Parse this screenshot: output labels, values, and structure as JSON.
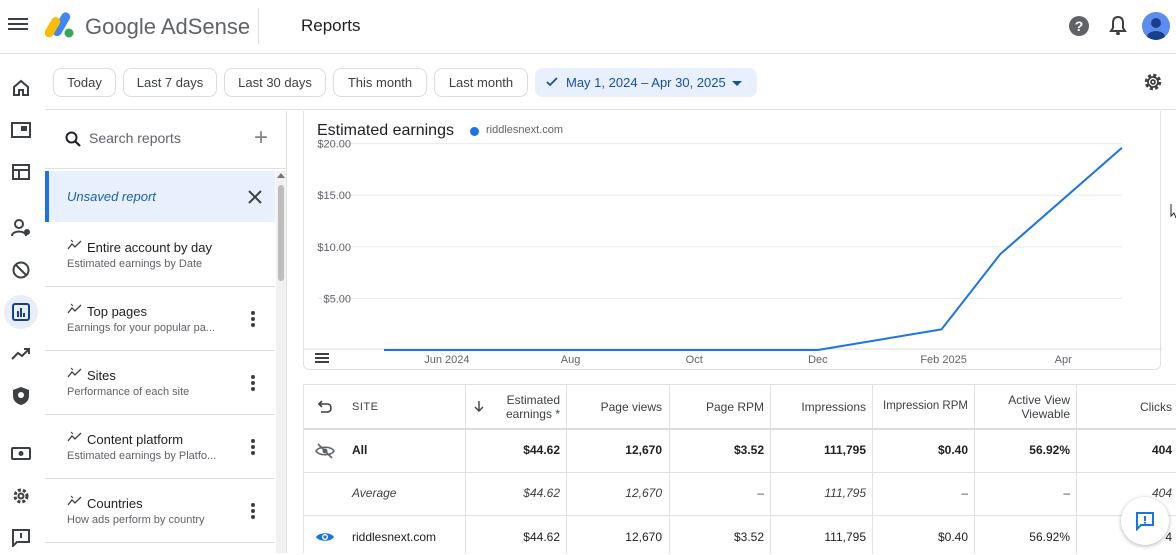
{
  "app": {
    "brand": "Google AdSense",
    "page_title": "Reports"
  },
  "topbar": {
    "help_glyph": "?"
  },
  "date_chips": [
    {
      "label": "Today",
      "active": false
    },
    {
      "label": "Last 7 days",
      "active": false
    },
    {
      "label": "Last 30 days",
      "active": false
    },
    {
      "label": "This month",
      "active": false
    },
    {
      "label": "Last month",
      "active": false
    },
    {
      "label": "May 1, 2024 – Apr 30, 2025",
      "active": true
    }
  ],
  "reports_panel": {
    "search_placeholder": "Search reports",
    "unsaved_label": "Unsaved report",
    "items": [
      {
        "title": "Entire account by day",
        "subtitle": "Estimated earnings by Date"
      },
      {
        "title": "Top pages",
        "subtitle": "Earnings for your popular pa..."
      },
      {
        "title": "Sites",
        "subtitle": "Performance of each site"
      },
      {
        "title": "Content platform",
        "subtitle": "Estimated earnings by Platfo..."
      },
      {
        "title": "Countries",
        "subtitle": "How ads perform by country"
      }
    ]
  },
  "chart": {
    "title": "Estimated earnings",
    "legend": "riddlesnext.com",
    "colors": {
      "series": "#1a73e8"
    }
  },
  "chart_data": {
    "type": "line",
    "title": "Estimated earnings",
    "y_ticks": [
      "$20.00",
      "$15.00",
      "$10.00",
      "$5.00"
    ],
    "x_ticks": [
      "Jun 2024",
      "Aug",
      "Oct",
      "Dec",
      "Feb 2025",
      "Apr"
    ],
    "ylim": [
      0,
      22
    ],
    "series": [
      {
        "name": "riddlesnext.com",
        "x": [
          "2024-05-01",
          "2024-12-01",
          "2025-01-31",
          "2025-03-01",
          "2025-04-30"
        ],
        "values": [
          0,
          0,
          2,
          9.3,
          19.6
        ]
      }
    ],
    "grid": true
  },
  "table": {
    "headers": [
      "SITE",
      "Estimated earnings *",
      "Page views",
      "Page RPM",
      "Impressions",
      "Impression RPM",
      "Active View Viewable",
      "Clicks"
    ],
    "header_earnings_line1": "Estimated",
    "header_earnings_line2": "earnings *",
    "header_active_line1": "Active View",
    "header_active_line2": "Viewable",
    "rows": [
      {
        "site": "All",
        "earnings": "$44.62",
        "page_views": "12,670",
        "page_rpm": "$3.52",
        "impressions": "111,795",
        "impression_rpm": "$0.40",
        "active_view": "56.92%",
        "clicks": "404"
      },
      {
        "site": "Average",
        "earnings": "$44.62",
        "page_views": "12,670",
        "page_rpm": "–",
        "impressions": "111,795",
        "impression_rpm": "–",
        "active_view": "–",
        "clicks": "404"
      },
      {
        "site": "riddlesnext.com",
        "earnings": "$44.62",
        "page_views": "12,670",
        "page_rpm": "$3.52",
        "impressions": "111,795",
        "impression_rpm": "$0.40",
        "active_view": "56.92%",
        "clicks": "4"
      }
    ]
  }
}
